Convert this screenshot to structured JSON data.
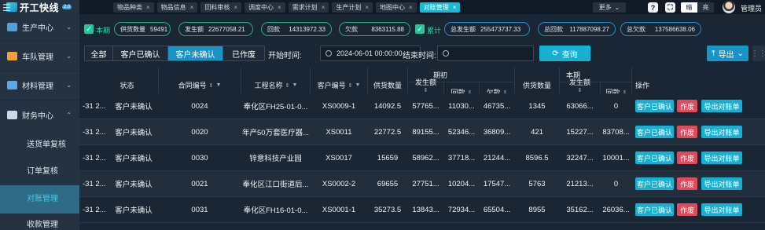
{
  "app": {
    "logo_text": "开工快线",
    "logo_version": "2.0"
  },
  "sidebar": {
    "items": [
      {
        "label": "生产中心",
        "icon": "factory-icon"
      },
      {
        "label": "车队管理",
        "icon": "truck-icon"
      },
      {
        "label": "材料管理",
        "icon": "materials-icon"
      },
      {
        "label": "财务中心",
        "icon": "finance-icon"
      }
    ],
    "sub_items": [
      "送货单复核",
      "订单复核",
      "对账管理",
      "收款管理"
    ],
    "active_sub": "对账管理"
  },
  "topbar": {
    "tabs": [
      "物品种类",
      "物品信息",
      "回料审核",
      "调度中心",
      "需求计划",
      "生产计划",
      "地图中心",
      "对账管理"
    ],
    "active_tab": "对账管理",
    "more_label": "更多",
    "theme_dark": "暗",
    "theme_light": "亮",
    "user_name": "管理员"
  },
  "summary": {
    "current_label": "本期",
    "cumulative_label": "累计",
    "current": [
      {
        "label": "供货数量",
        "value": "59491"
      },
      {
        "label": "发生额",
        "value": "22677058.21"
      },
      {
        "label": "回款",
        "value": "14313972.33"
      },
      {
        "label": "欠款",
        "value": "8363115.88"
      }
    ],
    "cumulative": [
      {
        "label": "总发生额",
        "value": "255473737.33"
      },
      {
        "label": "总回款",
        "value": "117887098.27"
      },
      {
        "label": "总欠款",
        "value": "137586638.06"
      }
    ]
  },
  "filters": {
    "segments": [
      "全部",
      "客户已确认",
      "客户未确认",
      "已作废"
    ],
    "active_segment": "客户未确认",
    "start_label": "开始时间:",
    "start_value": "2024-06-01 00:00:00",
    "end_label": "结束时间:",
    "end_value": "",
    "query_label": "查询",
    "export_label": "导出"
  },
  "table": {
    "headers": {
      "status": "状态",
      "contract_no": "合同编号",
      "project_name": "工程名称",
      "customer_no": "客户编号",
      "opening_group": "期初",
      "current_group": "本期",
      "supply_qty": "供货数量",
      "amount": "发生额",
      "payment": "回款",
      "arrears": "欠款",
      "actions": "操作"
    },
    "rows": [
      {
        "date": "-31 2...",
        "status": "客户未确认",
        "contract": "0024",
        "project": "奉化区FH25-01-0...",
        "customer": "XS0009-1",
        "o_qty": "14092.5",
        "o_amt": "57765...",
        "o_pay": "11030...",
        "o_debt": "46735...",
        "c_qty": "1345",
        "c_amt": "63066...",
        "c_pay": "0"
      },
      {
        "date": "-31 2...",
        "status": "客户未确认",
        "contract": "0020",
        "project": "年产50万套医疗器...",
        "customer": "XS0011",
        "o_qty": "22772.5",
        "o_amt": "89155...",
        "o_pay": "52346...",
        "o_debt": "36809...",
        "c_qty": "421",
        "c_amt": "15227...",
        "c_pay": "83708..."
      },
      {
        "date": "-31 2...",
        "status": "客户未确认",
        "contract": "0030",
        "project": "锌意科技产业园",
        "customer": "XS0017",
        "o_qty": "15659",
        "o_amt": "58962...",
        "o_pay": "37718...",
        "o_debt": "21244...",
        "c_qty": "8596.5",
        "c_amt": "32247...",
        "c_pay": "10001..."
      },
      {
        "date": "-31 2...",
        "status": "客户未确认",
        "contract": "0021",
        "project": "奉化区江口街道后...",
        "customer": "XS0002-2",
        "o_qty": "69655",
        "o_amt": "27751...",
        "o_pay": "10204...",
        "o_debt": "17547...",
        "c_qty": "5763",
        "c_amt": "21213...",
        "c_pay": "0"
      },
      {
        "date": "-31 2...",
        "status": "客户未确认",
        "contract": "0031",
        "project": "奉化区FH16-01-0...",
        "customer": "XS0001-1",
        "o_qty": "35273.5",
        "o_amt": "13843...",
        "o_pay": "72934...",
        "o_debt": "65504...",
        "c_qty": "8955",
        "c_amt": "35162...",
        "c_pay": "26036..."
      }
    ],
    "action_labels": {
      "confirm": "客户已确认",
      "void": "作废",
      "export": "导出对账单"
    }
  },
  "colors": {
    "accent": "#18b0d2",
    "danger": "#e04a5a",
    "success": "#1fb07f"
  }
}
